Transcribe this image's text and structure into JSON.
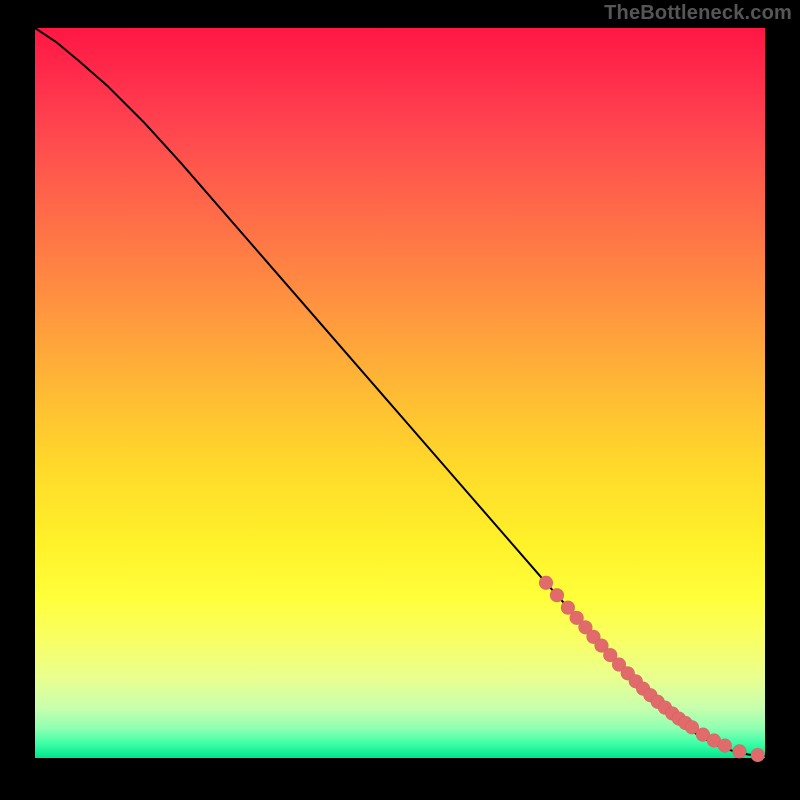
{
  "watermark": "TheBottleneck.com",
  "colors": {
    "dot": "#e16a6a",
    "line": "#000000",
    "frame": "#000000"
  },
  "chart_data": {
    "type": "line",
    "title": "",
    "xlabel": "",
    "ylabel": "",
    "xlim": [
      0,
      100
    ],
    "ylim": [
      0,
      100
    ],
    "grid": false,
    "legend": false,
    "series": [
      {
        "name": "curve",
        "kind": "line",
        "x": [
          0,
          3,
          6,
          10,
          15,
          20,
          30,
          40,
          50,
          60,
          70,
          78,
          84,
          88,
          91,
          93.5,
          95.5,
          97,
          98.5,
          100
        ],
        "y": [
          100,
          98,
          95.5,
          92,
          87,
          81.5,
          70,
          58.5,
          47,
          35.5,
          24,
          15,
          9,
          5.2,
          3.0,
          1.7,
          1.0,
          0.6,
          0.35,
          0.25
        ]
      },
      {
        "name": "points",
        "kind": "scatter",
        "x": [
          70,
          71.5,
          73,
          74.2,
          75.4,
          76.5,
          77.6,
          78.8,
          80,
          81.2,
          82.3,
          83.3,
          84.3,
          85.3,
          86.3,
          87.3,
          88.2,
          89.1,
          90,
          91.5,
          93,
          94.5,
          96.5,
          99
        ],
        "y": [
          24,
          22.3,
          20.6,
          19.2,
          17.9,
          16.6,
          15.4,
          14.1,
          12.8,
          11.6,
          10.5,
          9.5,
          8.6,
          7.7,
          6.9,
          6.1,
          5.4,
          4.8,
          4.2,
          3.2,
          2.4,
          1.7,
          0.9,
          0.4
        ]
      }
    ]
  }
}
